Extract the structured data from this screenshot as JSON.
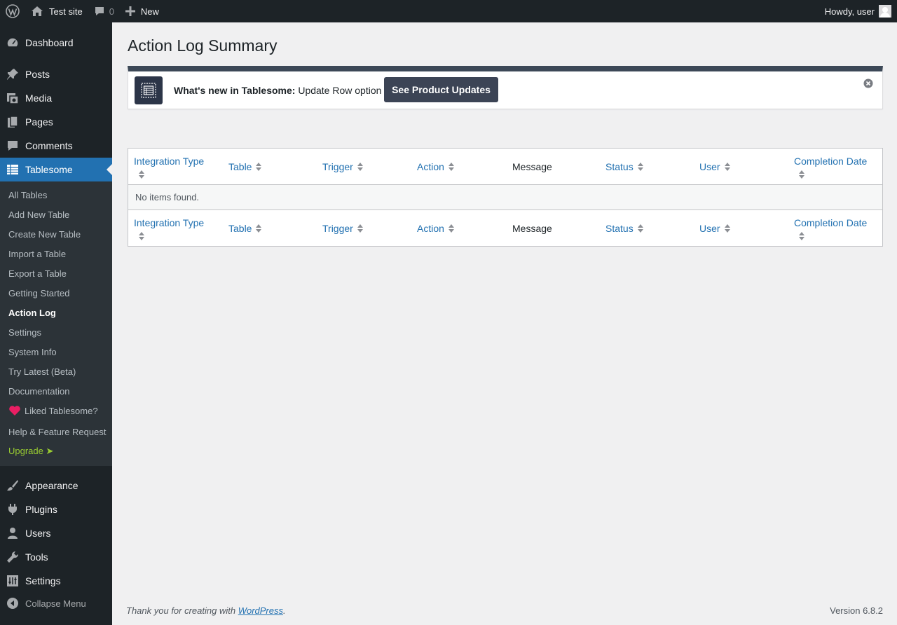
{
  "admin_bar": {
    "site_name": "Test site",
    "comments_count": "0",
    "new_label": "New",
    "greeting": "Howdy, user"
  },
  "sidebar": {
    "top_items": [
      {
        "label": "Dashboard",
        "icon": "dashboard-icon"
      },
      {
        "label": "Posts",
        "icon": "pin-icon"
      },
      {
        "label": "Media",
        "icon": "media-icon"
      },
      {
        "label": "Pages",
        "icon": "pages-icon"
      },
      {
        "label": "Comments",
        "icon": "comment-icon"
      },
      {
        "label": "Tablesome",
        "icon": "table-icon"
      }
    ],
    "submenu": [
      {
        "label": "All Tables"
      },
      {
        "label": "Add New Table"
      },
      {
        "label": "Create New Table"
      },
      {
        "label": "Import a Table"
      },
      {
        "label": "Export a Table"
      },
      {
        "label": "Getting Started"
      },
      {
        "label": "Action Log"
      },
      {
        "label": "Settings"
      },
      {
        "label": "System Info"
      },
      {
        "label": "Try Latest (Beta)"
      },
      {
        "label": "Documentation"
      },
      {
        "label": "Liked Tablesome?"
      },
      {
        "label": "Help & Feature Request"
      },
      {
        "label": "Upgrade ➤"
      }
    ],
    "bottom_items": [
      {
        "label": "Appearance",
        "icon": "brush-icon"
      },
      {
        "label": "Plugins",
        "icon": "plugin-icon"
      },
      {
        "label": "Users",
        "icon": "user-icon"
      },
      {
        "label": "Tools",
        "icon": "wrench-icon"
      },
      {
        "label": "Settings",
        "icon": "settings-icon"
      }
    ],
    "collapse_label": "Collapse Menu"
  },
  "page": {
    "title": "Action Log Summary"
  },
  "notice": {
    "bold_text": "What's new in Tablesome:",
    "text": " Update Row option",
    "button_label": "See Product Updates"
  },
  "table": {
    "columns": [
      {
        "label": "Integration Type",
        "sortable": true
      },
      {
        "label": "Table",
        "sortable": true
      },
      {
        "label": "Trigger",
        "sortable": true
      },
      {
        "label": "Action",
        "sortable": true
      },
      {
        "label": "Message",
        "sortable": false
      },
      {
        "label": "Status",
        "sortable": true
      },
      {
        "label": "User",
        "sortable": true
      },
      {
        "label": "Completion Date",
        "sortable": true
      }
    ],
    "empty_message": "No items found."
  },
  "footer": {
    "thanks_prefix": "Thank you for creating with ",
    "thanks_link": "WordPress",
    "thanks_suffix": ".",
    "version": "Version 6.8.2"
  },
  "colors": {
    "admin_bg": "#1d2327",
    "accent": "#2271b1",
    "submenu_bg": "#2c3338",
    "upgrade": "#9ACD32",
    "heart": "#e91e63"
  }
}
